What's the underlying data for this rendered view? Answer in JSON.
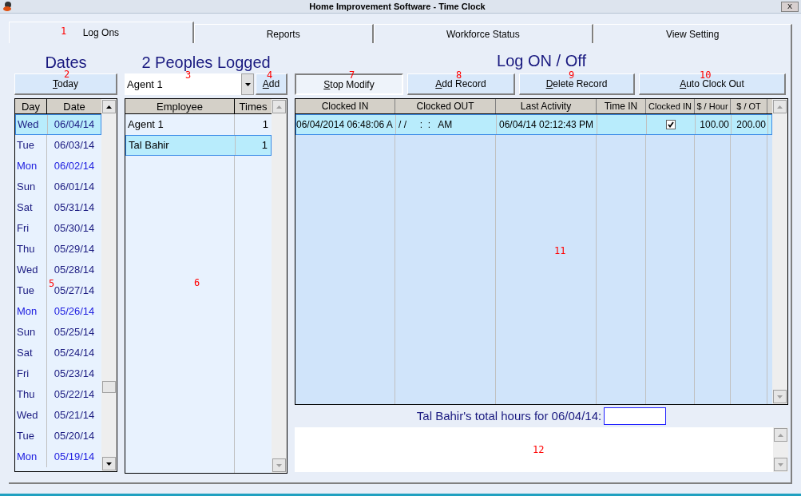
{
  "window": {
    "title": "Home Improvement Software - Time Clock",
    "close": "X"
  },
  "tabs": [
    {
      "label": "Log Ons",
      "selected": true
    },
    {
      "label": "Reports",
      "selected": false
    },
    {
      "label": "Workforce Status",
      "selected": false
    },
    {
      "label": "View Setting",
      "selected": false
    }
  ],
  "dates": {
    "heading": "Dates",
    "today_button": "Today",
    "columns": [
      "Day",
      "Date"
    ],
    "rows": [
      {
        "day": "Wed",
        "date": "06/04/14",
        "selected": true,
        "color": "#1a1a80"
      },
      {
        "day": "Tue",
        "date": "06/03/14",
        "selected": false,
        "color": "#1a1a80"
      },
      {
        "day": "Mon",
        "date": "06/02/14",
        "selected": false,
        "color": "#2020e0"
      },
      {
        "day": "Sun",
        "date": "06/01/14",
        "selected": false,
        "color": "#1a1a80"
      },
      {
        "day": "Sat",
        "date": "05/31/14",
        "selected": false,
        "color": "#1a1a80"
      },
      {
        "day": "Fri",
        "date": "05/30/14",
        "selected": false,
        "color": "#1a1a80"
      },
      {
        "day": "Thu",
        "date": "05/29/14",
        "selected": false,
        "color": "#1a1a80"
      },
      {
        "day": "Wed",
        "date": "05/28/14",
        "selected": false,
        "color": "#1a1a80"
      },
      {
        "day": "Tue",
        "date": "05/27/14",
        "selected": false,
        "color": "#1a1a80"
      },
      {
        "day": "Mon",
        "date": "05/26/14",
        "selected": false,
        "color": "#2020e0"
      },
      {
        "day": "Sun",
        "date": "05/25/14",
        "selected": false,
        "color": "#1a1a80"
      },
      {
        "day": "Sat",
        "date": "05/24/14",
        "selected": false,
        "color": "#1a1a80"
      },
      {
        "day": "Fri",
        "date": "05/23/14",
        "selected": false,
        "color": "#1a1a80"
      },
      {
        "day": "Thu",
        "date": "05/22/14",
        "selected": false,
        "color": "#1a1a80"
      },
      {
        "day": "Wed",
        "date": "05/21/14",
        "selected": false,
        "color": "#1a1a80"
      },
      {
        "day": "Tue",
        "date": "05/20/14",
        "selected": false,
        "color": "#1a1a80"
      },
      {
        "day": "Mon",
        "date": "05/19/14",
        "selected": false,
        "color": "#2020e0"
      }
    ]
  },
  "people": {
    "heading": "2 Peoples Logged",
    "agent_select": {
      "value": "Agent 1"
    },
    "add_button": "Add",
    "columns": [
      "Employee",
      "Times"
    ],
    "rows": [
      {
        "employee": "Agent 1",
        "times": "1",
        "selected": false
      },
      {
        "employee": "Tal Bahir",
        "times": "1",
        "selected": true
      }
    ]
  },
  "log": {
    "heading": "Log ON / Off",
    "buttons": [
      {
        "label": "Stop Modify",
        "pressed": true
      },
      {
        "label": "Add Record",
        "pressed": false
      },
      {
        "label": "Delete Record",
        "pressed": false
      },
      {
        "label": "Auto Clock Out",
        "pressed": false
      }
    ],
    "columns": [
      "Clocked IN",
      "Clocked OUT",
      "Last Activity",
      "Time IN",
      "Clocked IN",
      "$ / Hour",
      "$ / OT"
    ],
    "rows": [
      {
        "clocked_in": "06/04/2014 06:48:06 A",
        "clocked_out": "/ /     :  :   AM",
        "last_activity": "06/04/14 02:12:43 PM",
        "time_in": "",
        "clocked_in_checked": true,
        "per_hour": "100.00",
        "per_ot": "200.00",
        "selected": true
      }
    ],
    "total_label": "Tal Bahir's total hours for 06/04/14:"
  },
  "callouts": [
    "1",
    "2",
    "3",
    "4",
    "5",
    "6",
    "7",
    "8",
    "9",
    "10",
    "11",
    "12"
  ]
}
